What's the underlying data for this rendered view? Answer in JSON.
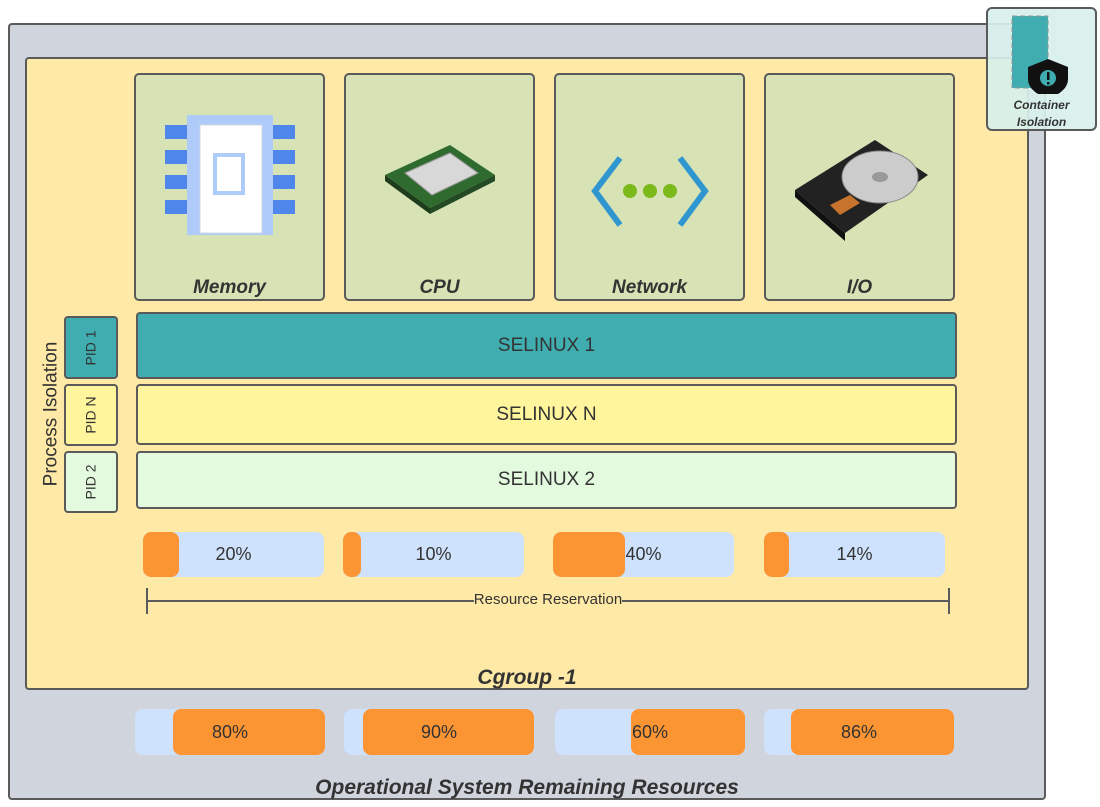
{
  "container_isolation": {
    "label": "Container Isolation"
  },
  "resources": [
    {
      "label": "Memory",
      "icon": "memory-chip-icon"
    },
    {
      "label": "CPU",
      "icon": "cpu-icon"
    },
    {
      "label": "Network",
      "icon": "network-icon"
    },
    {
      "label": "I/O",
      "icon": "hard-disk-icon"
    }
  ],
  "process_isolation": {
    "label": "Process Isolation",
    "rows": [
      {
        "pid": "PID 1",
        "selinux": "SELINUX 1",
        "color": "#40aeb0"
      },
      {
        "pid": "PID N",
        "selinux": "SELINUX N",
        "color": "#fff59d"
      },
      {
        "pid": "PID 2",
        "selinux": "SELINUX 2",
        "color": "#e3fadf"
      }
    ]
  },
  "reservation": {
    "label": "Resource Reservation",
    "bars": [
      {
        "label": "20%",
        "value": 20
      },
      {
        "label": "10%",
        "value": 10
      },
      {
        "label": "40%",
        "value": 40
      },
      {
        "label": "14%",
        "value": 14
      }
    ]
  },
  "cgroup": {
    "label": "Cgroup -1"
  },
  "remaining": {
    "label": "Operational System Remaining Resources",
    "bars": [
      {
        "label": "80%",
        "value": 80
      },
      {
        "label": "90%",
        "value": 90
      },
      {
        "label": "60%",
        "value": 60
      },
      {
        "label": "86%",
        "value": 86
      }
    ]
  },
  "colors": {
    "orange": "#fb9433",
    "light_blue": "#cfe2fd",
    "cgroup_bg": "#ffe9a6",
    "os_bg": "#d0d5dd",
    "card_bg": "#d7e2b5"
  }
}
